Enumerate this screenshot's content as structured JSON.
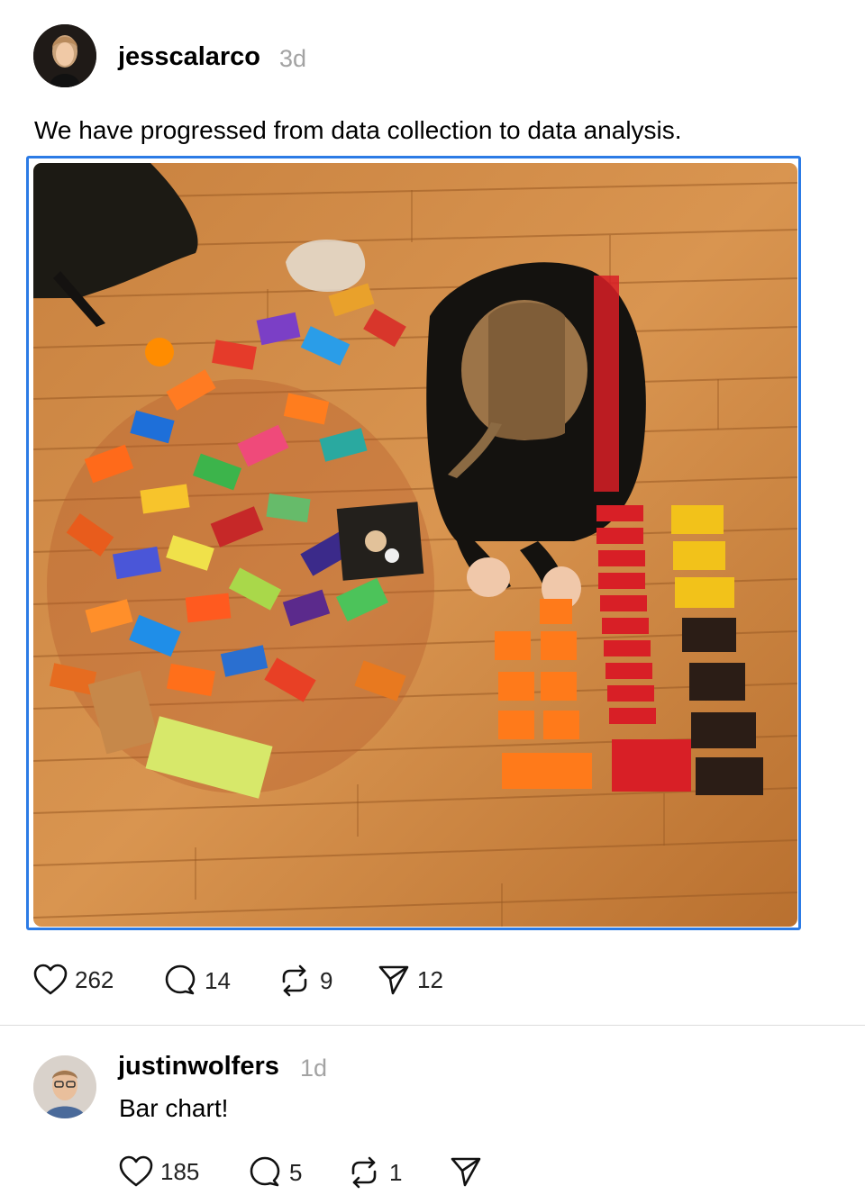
{
  "post": {
    "username": "jesscalarco",
    "time": "3d",
    "text": "We have progressed from data collection to data analysis.",
    "actions": {
      "likes": "262",
      "replies": "14",
      "reposts": "9",
      "shares": "12"
    }
  },
  "reply": {
    "username": "justinwolfers",
    "time": "1d",
    "text": "Bar chart!",
    "actions": {
      "likes": "185",
      "replies": "5",
      "reposts": "1"
    }
  },
  "colors": {
    "accent_border": "#2c7be5",
    "muted_text": "#a3a3a3"
  },
  "icons": [
    "heart-icon",
    "comment-icon",
    "repost-icon",
    "send-icon"
  ]
}
